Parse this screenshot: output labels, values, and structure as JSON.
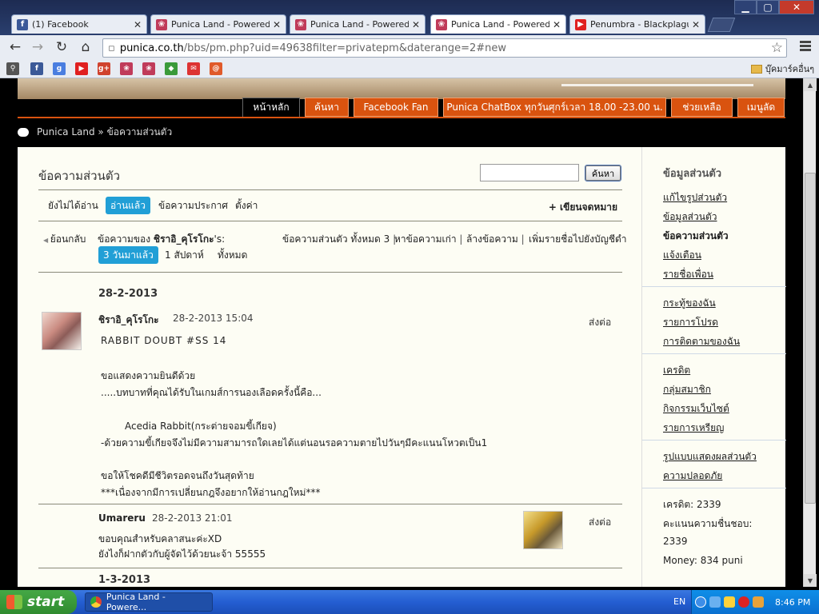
{
  "browser": {
    "tabs": [
      {
        "label": "(1) Facebook",
        "favicon": "facebook-icon"
      },
      {
        "label": "Punica Land - Powered b",
        "favicon": "punica-icon"
      },
      {
        "label": "Punica Land - Powered b",
        "favicon": "punica-icon"
      },
      {
        "label": "Punica Land - Powered b",
        "favicon": "punica-icon"
      },
      {
        "label": "Penumbra - Blackplague",
        "favicon": "youtube-icon"
      }
    ],
    "url_host": "punica.co.th",
    "url_rest": "/bbs/pm.php?uid=49638filter=privatepm&daterange=2#new",
    "bookmarks_folder": "บุ๊คมาร์คอื่นๆ"
  },
  "site": {
    "nav": [
      "หน้าหลัก",
      "ค้นหา",
      "Facebook Fan",
      "Punica ChatBox ทุกวันศุกร์เวลา 18.00 -23.00 น.",
      "ช่วยเหลือ",
      "เมนูลัด"
    ],
    "breadcrumb": "Punica Land » ข้อความส่วนตัว"
  },
  "main": {
    "title": "ข้อความส่วนตัว",
    "search_button": "ค้นหา",
    "tabs": [
      "ยังไม่ได้อ่าน",
      "อ่านแล้ว",
      "ข้อความประกาศ",
      "ตั้งค่า"
    ],
    "compose": "+ เขียนจดหมาย",
    "back": "ย้อนกลับ",
    "from_prefix": "ข้อความของ",
    "from_user": "ชิราอิ_คุโรโกะ",
    "from_suffix": "'s:",
    "total": "ข้อความส่วนตัว ทั้งหมด 3",
    "find_old": "หาข้อความเก่า",
    "clear": "ล้างข้อความ",
    "blacklist": "เพิ่มรายชื่อไปยังบัญชีดำ",
    "range": [
      "3 วันมาแล้ว",
      "1 สัปดาห์",
      "ทั้งหมด"
    ]
  },
  "messages": {
    "date1": "28-2-2013",
    "m1": {
      "author": "ชิราอิ_คุโรโกะ",
      "time": "28-2-2013 15:04",
      "forward": "ส่งต่อ",
      "lines": [
        "RABBIT DOUBT #SS 14",
        "ขอแสดงความยินดีด้วย",
        ".....บทบาทที่คุณได้รับในเกมส์การนองเลือดครั้งนี้คือ...",
        "Acedia Rabbit(กระต่ายจอมขี้เกียจ)",
        "-ด้วยความขี้เกียจจึงไม่มีความสามารถใดเลยได้แต่นอนรอความตายไปวันๆมีคะแนนโหวตเป็น1",
        "ขอให้โชคดีมีชีวิตรอดจนถึงวันสุดท้าย",
        "***เนื่องจากมีการเปลี่ยนกฎจึงอยากให้อ่านกฎใหม่***"
      ]
    },
    "m2": {
      "author": "Umareru",
      "time": "28-2-2013 21:01",
      "forward": "ส่งต่อ",
      "lines": [
        "ขอบคุณสำหรับคลาสนะค่ะXD",
        "ยังไงก็ฝากตัวกับผู้จัดไว้ด้วยนะจ้า 55555"
      ]
    },
    "date2": "1-3-2013"
  },
  "sidebar": {
    "heading": "ข้อมูลส่วนตัว",
    "group1": [
      "แก้ไขรูปส่วนตัว",
      "ข้อมูลส่วนตัว",
      "ข้อความส่วนตัว",
      "แจ้งเตือน",
      "รายชื่อเพื่อน"
    ],
    "group2": [
      "กระทู้ของฉัน",
      "รายการโปรด",
      "การติดตามของฉัน"
    ],
    "group3": [
      "เครดิต",
      "กลุ่มสมาชิก",
      "กิจกรรมเว็บไซต์",
      "รายการเหรียญ"
    ],
    "group4": [
      "รูปแบบแสดงผลส่วนตัว",
      "ความปลอดภัย"
    ],
    "stats": [
      "เครดิต: 2339",
      "คะแนนความชื่นชอบ:",
      "2339",
      "Money: 834 puni"
    ]
  },
  "taskbar": {
    "start": "start",
    "task": "Punica Land - Powere...",
    "lang": "EN",
    "clock": "8:46 PM"
  },
  "colors": {
    "accent": "#219fd6",
    "nav": "#d9530f"
  }
}
